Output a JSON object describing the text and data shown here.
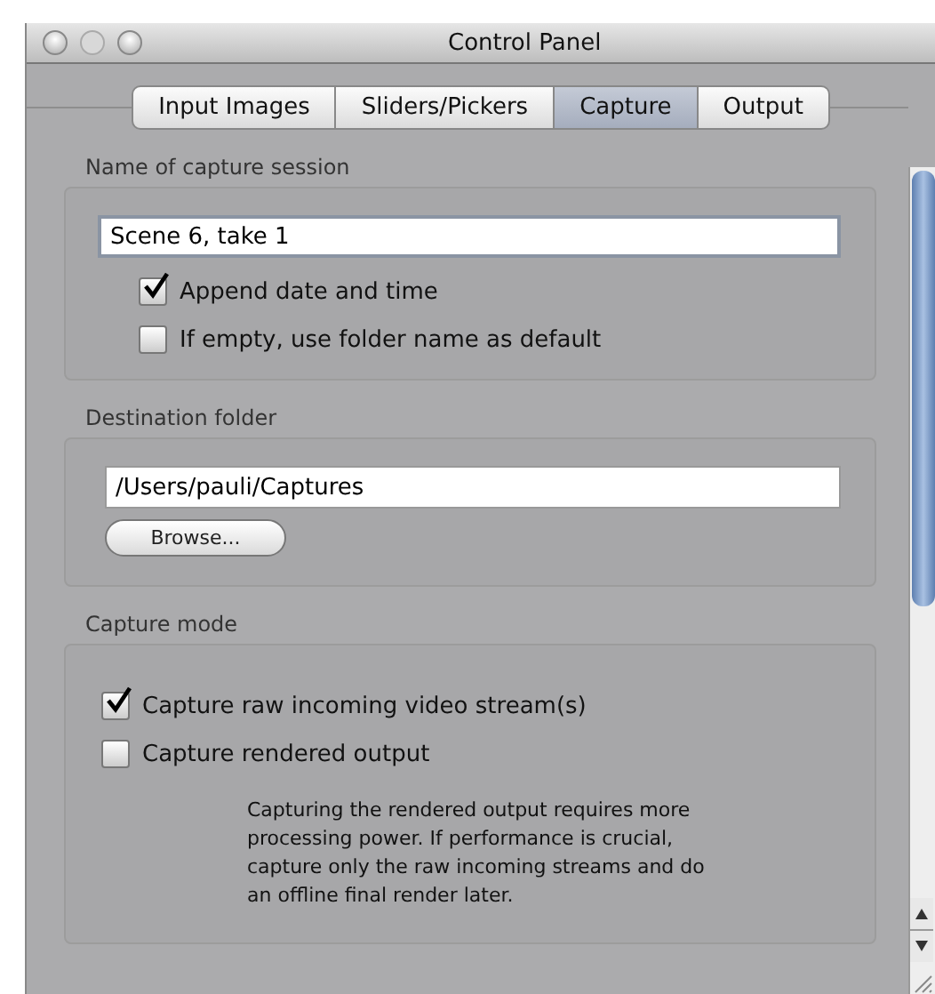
{
  "window": {
    "title": "Control Panel"
  },
  "tabs": [
    {
      "label": "Input Images",
      "selected": false
    },
    {
      "label": "Sliders/Pickers",
      "selected": false
    },
    {
      "label": "Capture",
      "selected": true
    },
    {
      "label": "Output",
      "selected": false
    }
  ],
  "sections": [
    {
      "title": "Name of capture session",
      "field": {
        "value": "Scene 6, take 1"
      },
      "checkboxes": [
        {
          "label": "Append date and time",
          "checked": true
        },
        {
          "label": "If empty, use folder name as default",
          "checked": false
        }
      ]
    },
    {
      "title": "Destination folder",
      "field": {
        "value": "/Users/pauli/Captures"
      },
      "button": "Browse..."
    },
    {
      "title": "Capture mode",
      "checkboxes": [
        {
          "label": "Capture raw incoming video stream(s)",
          "checked": true
        },
        {
          "label": "Capture rendered output",
          "checked": false
        }
      ],
      "note": "Capturing the rendered output requires more processing power. If performance is crucial, capture only the raw incoming streams and do an offline final render later."
    }
  ]
}
